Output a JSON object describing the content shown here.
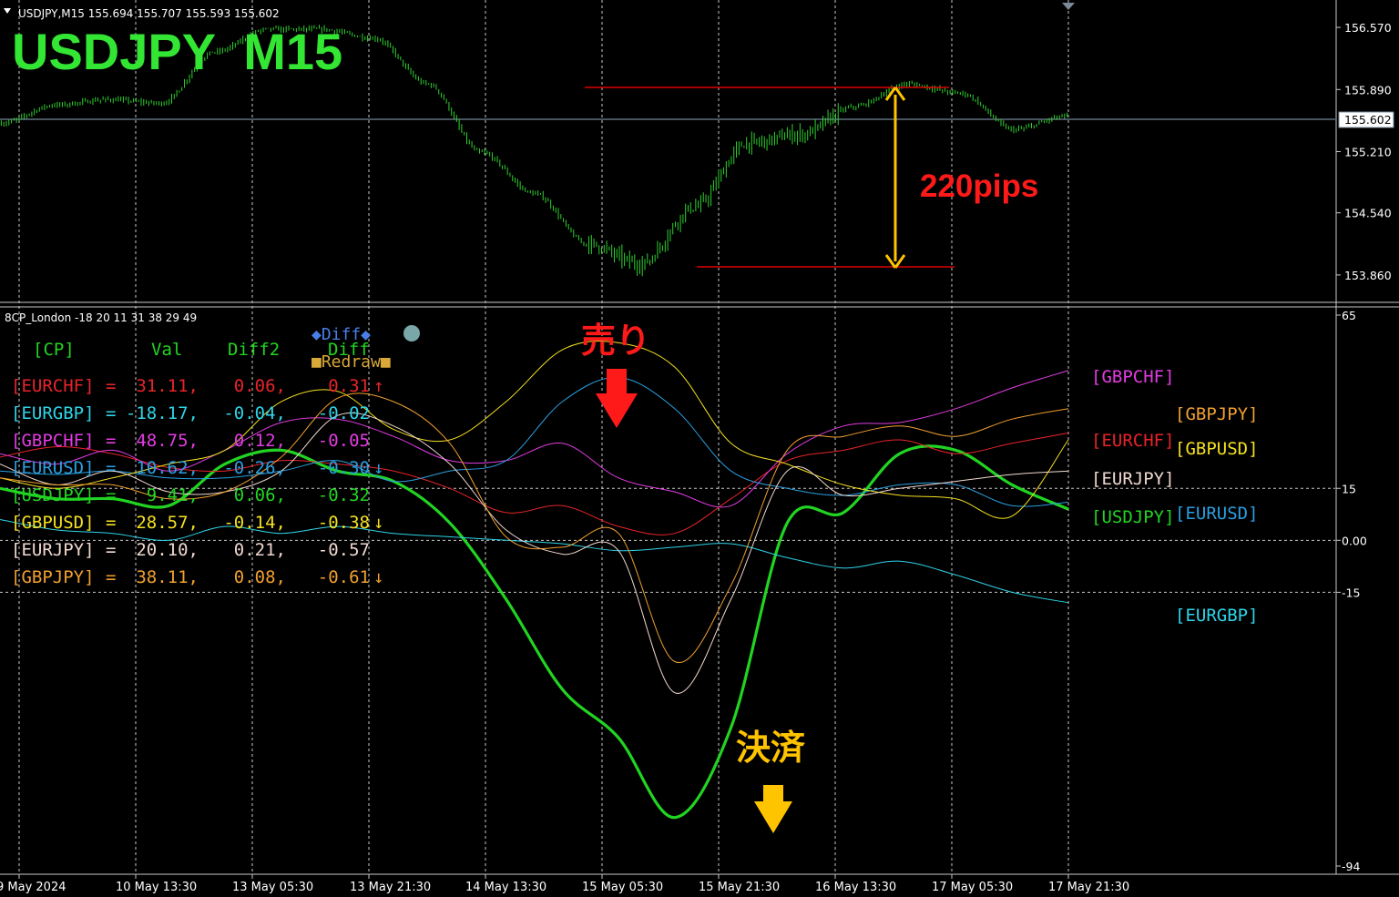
{
  "window": {
    "symbol_info": "USDJPY,M15  155.694 155.707 155.593 155.602",
    "big_title": "USDJPY  M15",
    "indicator_info": "8CP_London -18 20 11 31 38 29 49"
  },
  "price_axis": {
    "ticks": [
      "156.570",
      "155.890",
      "155.210",
      "154.540",
      "153.860"
    ],
    "current_price": "155.602"
  },
  "indicator_axis": {
    "ticks": [
      "65",
      "15",
      "0.00",
      "-15",
      "-94"
    ]
  },
  "time_axis": {
    "labels": [
      "9 May 2024",
      "10 May 13:30",
      "13 May 05:30",
      "13 May 21:30",
      "14 May 13:30",
      "15 May 05:30",
      "15 May 21:30",
      "16 May 13:30",
      "17 May 05:30",
      "17 May 21:30"
    ]
  },
  "annotations": {
    "pips": "220pips",
    "sell": "売り",
    "settle": "決済"
  },
  "controls": {
    "diff_button": "◆Diff◆",
    "diff_label": "Diff",
    "redraw_button": "■Redraw■"
  },
  "table": {
    "headers": [
      "[CP]",
      "Val",
      "Diff2",
      "Diff"
    ],
    "rows": [
      {
        "pair": "[EURCHF]",
        "eq": "=",
        "val": "31.11,",
        "diff2": "0.06,",
        "diff": "0.31",
        "arrow": "↑",
        "color": "#e8242a"
      },
      {
        "pair": "[EURGBP]",
        "eq": "=",
        "val": "-18.17,",
        "diff2": "-0.04,",
        "diff": "-0.02",
        "arrow": "",
        "color": "#2fd4e8"
      },
      {
        "pair": "[GBPCHF]",
        "eq": "=",
        "val": "48.75,",
        "diff2": "0.12,",
        "diff": "-0.05",
        "arrow": "",
        "color": "#e23ce2"
      },
      {
        "pair": "[EURUSD]",
        "eq": "=",
        "val": "10.62,",
        "diff2": "-0.26,",
        "diff": "-0.30",
        "arrow": "↓",
        "color": "#2a9fe0"
      },
      {
        "pair": "[USDJPY]",
        "eq": "=",
        "val": "9.41,",
        "diff2": "0.06,",
        "diff": "-0.32",
        "arrow": "",
        "color": "#22d422"
      },
      {
        "pair": "[GBPUSD]",
        "eq": "=",
        "val": "28.57,",
        "diff2": "-0.14,",
        "diff": "-0.38",
        "arrow": "↓",
        "color": "#f4e020"
      },
      {
        "pair": "[EURJPY]",
        "eq": "=",
        "val": "20.10,",
        "diff2": "0.21,",
        "diff": "-0.57",
        "arrow": "",
        "color": "#f0d8d0"
      },
      {
        "pair": "[GBPJPY]",
        "eq": "=",
        "val": "38.11,",
        "diff2": "0.08,",
        "diff": "-0.61",
        "arrow": "↓",
        "color": "#f0a030"
      }
    ]
  },
  "legend": [
    {
      "label": "[GBPCHF]",
      "color": "#e23ce2"
    },
    {
      "label": "[GBPJPY]",
      "color": "#f0a030"
    },
    {
      "label": "[EURCHF]",
      "color": "#e8242a"
    },
    {
      "label": "[GBPUSD]",
      "color": "#f4e020"
    },
    {
      "label": "[EURJPY]",
      "color": "#f0d8d0"
    },
    {
      "label": "[USDJPY]",
      "color": "#22d422"
    },
    {
      "label": "[EURUSD]",
      "color": "#2a9fe0"
    },
    {
      "label": "[EURGBP]",
      "color": "#2fd4e8"
    }
  ],
  "colors": {
    "background": "#000000",
    "grid": "#c8c8c8",
    "candles": "#2ed12e",
    "title_green": "#33e633",
    "pips_red": "#ff1a1a",
    "arrow_yellow": "#ffc400",
    "horizontal_lines": "#e00000"
  },
  "chart_data": [
    {
      "type": "line",
      "title": "USDJPY  M15",
      "ylim": [
        153.56,
        156.87
      ],
      "y_ticks": [
        156.57,
        155.89,
        155.21,
        154.54,
        153.86
      ],
      "current_price": 155.602,
      "x": [
        "9 May 2024",
        "10 May 13:30",
        "13 May 05:30",
        "13 May 21:30",
        "14 May 13:30",
        "15 May 05:30",
        "15 May 21:30",
        "16 May 13:30",
        "17 May 05:30",
        "17 May 21:30"
      ],
      "series": [
        {
          "values": [
            155.52,
            155.72,
            155.78,
            155.74,
            156.3,
            156.55,
            156.55,
            156.45,
            155.95,
            155.2,
            154.75,
            154.2,
            153.98,
            154.6,
            155.3,
            155.4,
            155.7,
            155.95,
            155.85,
            155.45,
            155.6
          ]
        }
      ],
      "levels": [
        155.98,
        153.92
      ],
      "range_annotation": "220pips"
    },
    {
      "type": "line",
      "title": "8CP_London -18 20 11 31 38 29 49",
      "ylim": [
        -94,
        65
      ],
      "y_ticks": [
        65,
        15,
        0,
        -15,
        -94
      ],
      "series": [
        {
          "name": "[USDJPY]",
          "values": [
            15,
            12,
            12,
            10,
            22,
            26,
            20,
            17,
            5,
            -17,
            -43,
            -57,
            -80,
            -54,
            5,
            8,
            25,
            26,
            16,
            9
          ]
        },
        {
          "name": "[EURCHF]",
          "values": [
            24,
            27,
            25,
            21,
            20,
            23,
            22,
            20,
            15,
            8,
            10,
            4,
            2,
            12,
            23,
            26,
            29,
            25,
            28,
            31
          ]
        },
        {
          "name": "[EURGBP]",
          "values": [
            6,
            3,
            2,
            0,
            4,
            2,
            4,
            2,
            1,
            0,
            -1,
            -3,
            -2,
            -1,
            -5,
            -8,
            -6,
            -10,
            -15,
            -18
          ]
        },
        {
          "name": "[GBPCHF]",
          "values": [
            25,
            22,
            26,
            20,
            26,
            34,
            35,
            30,
            23,
            23,
            28,
            18,
            14,
            10,
            25,
            33,
            34,
            38,
            44,
            49
          ]
        },
        {
          "name": "[EURUSD]",
          "values": [
            20,
            19,
            20,
            18,
            18,
            20,
            23,
            17,
            20,
            23,
            40,
            47,
            38,
            20,
            15,
            13,
            16,
            16,
            10,
            11
          ]
        },
        {
          "name": "[GBPUSD]",
          "values": [
            18,
            15,
            18,
            22,
            26,
            40,
            43,
            32,
            29,
            40,
            55,
            57,
            50,
            28,
            22,
            16,
            13,
            12,
            7,
            29
          ]
        },
        {
          "name": "[EURJPY]",
          "values": [
            22,
            16,
            20,
            14,
            14,
            20,
            36,
            33,
            22,
            3,
            -4,
            -3,
            -44,
            -17,
            20,
            13,
            15,
            17,
            19,
            20
          ]
        },
        {
          "name": "[GBPJPY]",
          "values": [
            18,
            16,
            16,
            12,
            14,
            24,
            41,
            40,
            28,
            1,
            -2,
            2,
            -35,
            -13,
            26,
            30,
            33,
            30,
            35,
            38
          ]
        }
      ]
    }
  ]
}
